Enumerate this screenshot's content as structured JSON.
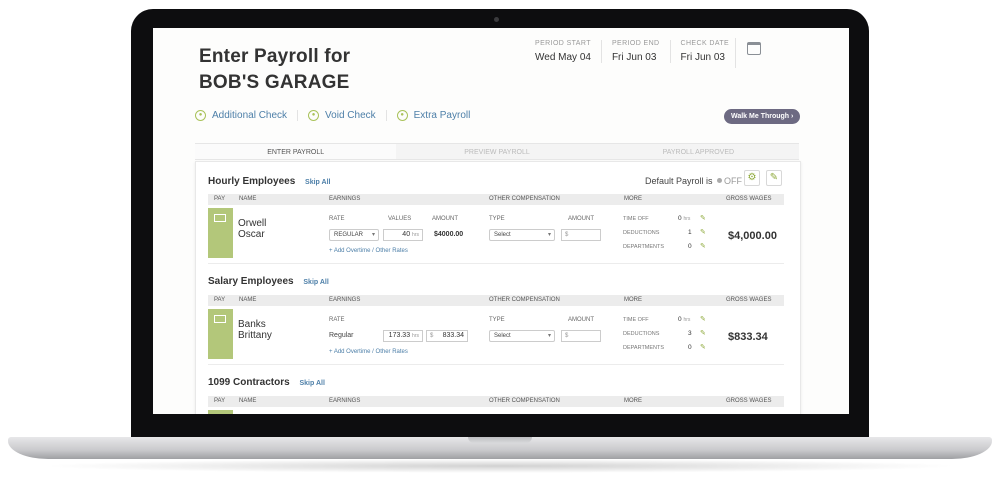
{
  "page": {
    "title_line1": "Enter Payroll for",
    "title_line2": "BOB'S GARAGE",
    "period_start_label": "PERIOD START",
    "period_start_value": "Wed May 04",
    "period_end_label": "PERIOD END",
    "period_end_value": "Fri Jun 03",
    "check_date_label": "CHECK DATE",
    "check_date_value": "Fri Jun 03"
  },
  "actions": {
    "additional_check": "Additional Check",
    "void_check": "Void Check",
    "extra_payroll": "Extra Payroll",
    "walk_me_through": "Walk Me Through ›"
  },
  "steps": [
    "ENTER PAYROLL",
    "PREVIEW PAYROLL",
    "PAYROLL APPROVED"
  ],
  "default_payroll": {
    "label": "Default Payroll is",
    "state": "OFF"
  },
  "columns": {
    "pay": "PAY",
    "name": "NAME",
    "earnings": "EARNINGS",
    "other_comp": "OTHER COMPENSATION",
    "more": "MORE",
    "gross": "GROSS WAGES"
  },
  "subcolumns": {
    "rate": "RATE",
    "values": "VALUES",
    "amount": "AMOUNT",
    "type": "TYPE"
  },
  "sections": {
    "hourly": {
      "title": "Hourly Employees",
      "skip": "Skip All",
      "employee": {
        "last": "Orwell",
        "first": "Oscar",
        "rate": "REGULAR",
        "hours": "40",
        "hours_unit": "hrs",
        "amount": "$4000.00",
        "type": "Select",
        "dollar": "$",
        "add_link": "+ Add Overtime / Other Rates",
        "time_off_label": "TIME OFF",
        "time_off": "0",
        "time_off_unit": "hrs",
        "deductions_label": "DEDUCTIONS",
        "deductions": "1",
        "departments_label": "DEPARTMENTS",
        "departments": "0",
        "gross": "$4,000.00"
      }
    },
    "salary": {
      "title": "Salary Employees",
      "skip": "Skip All",
      "employee": {
        "last": "Banks",
        "first": "Brittany",
        "rate": "Regular",
        "hours": "173.33",
        "hours_unit": "hrs",
        "dollar": "$",
        "amount": "833.34",
        "type": "Select",
        "add_link": "+ Add Overtime / Other Rates",
        "time_off_label": "TIME OFF",
        "time_off": "0",
        "time_off_unit": "hrs",
        "deductions_label": "DEDUCTIONS",
        "deductions": "3",
        "departments_label": "DEPARTMENTS",
        "departments": "0",
        "gross": "$833.34"
      }
    },
    "contractors": {
      "title": "1099 Contractors",
      "skip": "Skip All"
    }
  },
  "colors": {
    "accent_green": "#b3c77a",
    "link_blue": "#4d7fa8",
    "walk_button": "#6d6a82"
  },
  "icons": [
    "calendar-icon",
    "circle-icon",
    "gear-icon",
    "pencil-icon",
    "paycheck-icon",
    "bank-icon"
  ]
}
